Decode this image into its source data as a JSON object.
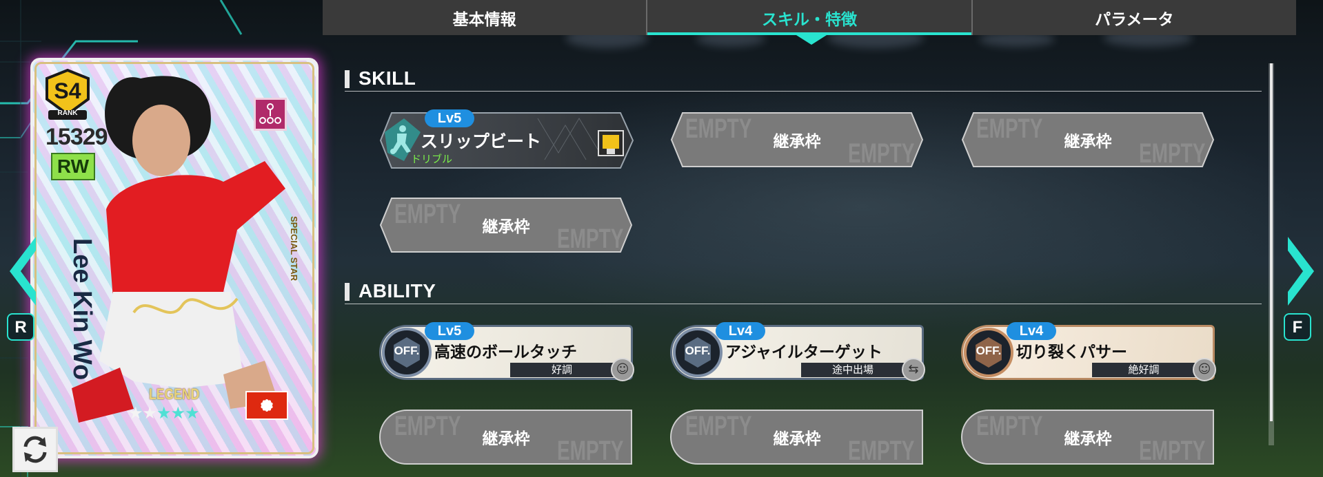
{
  "tabs": [
    {
      "label": "基本情報",
      "active": false
    },
    {
      "label": "スキル・特徴",
      "active": true
    },
    {
      "label": "パラメータ",
      "active": false
    }
  ],
  "sections": {
    "skill": "SKILL",
    "ability": "ABILITY"
  },
  "skill": {
    "level": "Lv5",
    "name": "スリップビート",
    "category": "ドリブル",
    "icon": "dribble-player-icon"
  },
  "empty_slot": {
    "label": "継承枠",
    "watermark": "EMPTY"
  },
  "abilities": [
    {
      "level": "Lv5",
      "badge": "OFF.",
      "name": "高速のボールタッチ",
      "condition": "好調",
      "tier": "silver"
    },
    {
      "level": "Lv4",
      "badge": "OFF.",
      "name": "アジャイルターゲット",
      "condition": "途中出場",
      "tier": "silver"
    },
    {
      "level": "Lv4",
      "badge": "OFF.",
      "name": "切り裂くパサー",
      "condition": "絶好調",
      "tier": "bronze"
    }
  ],
  "player": {
    "rank": "S4",
    "rank_label": "RANK",
    "rating": "15329",
    "position": "RW",
    "name": "Lee Kin Wo",
    "edition": "SPECIAL STAR",
    "type": "LEGEND",
    "stars_filled": 5,
    "flag": "hong-kong-flag"
  },
  "nav": {
    "left_key": "R",
    "right_key": "F"
  },
  "colors": {
    "accent": "#29e3cf",
    "tab_bg": "#3a3a3a",
    "level_pill": "#1f8fe0",
    "slot_gray": "#7a7a7a"
  }
}
